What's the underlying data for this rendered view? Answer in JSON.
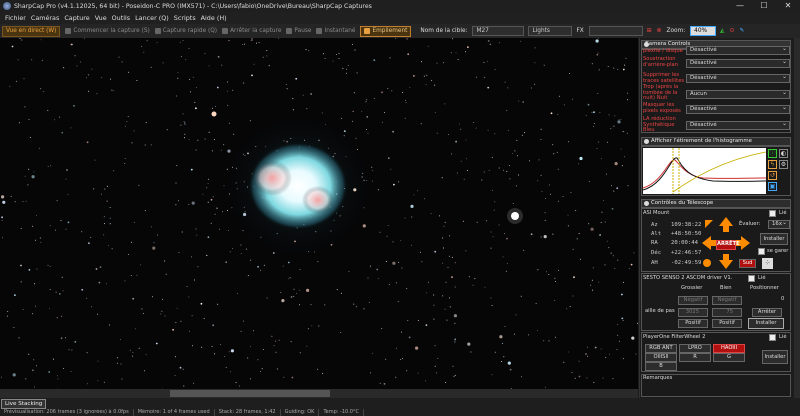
{
  "window": {
    "title": "SharpCap Pro (v4.1.12025, 64 bit) - Poseidon-C PRO (IMX571) - C:\\Users\\fabio\\OneDrive\\Bureau\\SharpCap Captures",
    "min": "—",
    "max": "☐",
    "close": "✕"
  },
  "menu": [
    "Fichier",
    "Caméras",
    "Capture",
    "Vue",
    "Outils",
    "Lancer (Q)",
    "Scripts",
    "Aide (H)"
  ],
  "toolbar": {
    "live": "Vue en direct (W)",
    "start_capture": "Commencer la capture (S)",
    "quick_capture": "Capture rapide (Q)",
    "stop_capture": "Arrêter la capture",
    "pause": "Pause",
    "snapshot": "Instantané",
    "stacking": "Empilement",
    "target_label": "Nom de la cible:",
    "target_value": "M27",
    "frame_type": "Lights",
    "fx_label": "FX",
    "zoom_label": "Zoom:",
    "zoom_value": "40%"
  },
  "panel": {
    "camera_controls_title": "Camera Controls",
    "camera_rows": [
      {
        "label": "plexite / disque",
        "value": "Désactivé"
      },
      {
        "label": "Soustraction d'arrière-plan",
        "value": "Désactivé"
      },
      {
        "label": "Supprimer les traces satellites",
        "value": "Désactivé"
      },
      {
        "label": "Trop (après la tombée de la nuit) Nuit",
        "value": "Aucun"
      },
      {
        "label": "Masquer les pixels exposés",
        "value": "Désactivé"
      },
      {
        "label": "LA réduction Synthétique Bleu",
        "value": "Désactivé"
      }
    ],
    "histogram_title": "Afficher l'étirement de l'histogramme",
    "telescope_title": "Contrôles du Télescope",
    "mount": {
      "name": "ASI Mount",
      "linked_label": "Lié",
      "az": "109:38:22",
      "alt": "+48:50:50",
      "ra": "20:00:44",
      "dec": "+22:46:57",
      "ah": "-02:49:59",
      "coord_labels": [
        "Az",
        "Alt",
        "RA",
        "Déc",
        "AH"
      ],
      "slew_label": "Évaluer:",
      "slew_value": "16x",
      "install_button": "Installer",
      "stop_button": "ARRÊTE",
      "south_label": "Sud",
      "park_label": "se garer"
    },
    "focuser": {
      "name": "SESTO SENSO 2 ASCOM driver V1.",
      "linked_label": "Lié",
      "col_coarse": "Grossier",
      "col_fine": "Bien",
      "col_position": "Positionner",
      "neg_label": "Négatif",
      "pos_label": "Positif",
      "step_label": "aille de pas",
      "coarse_step": "3025",
      "fine_step": "75",
      "position_value": "0",
      "stop_button": "Arrêter",
      "install_button": "Installer"
    },
    "filterwheel": {
      "name": "PlayerOne FilterWheel 2",
      "linked_label": "Lié",
      "filters": [
        "RGB ANT",
        "LPRO",
        "HAOIII",
        "OIIISII",
        "R",
        "G",
        "B"
      ],
      "active_filter": "HAOIII",
      "install_button": "Installer"
    },
    "remarks_label": "Remarques"
  },
  "status": {
    "live_tab": "Live Stacking",
    "items": [
      "Prévisualisation: 206 trames (3 ignorées) à 0.0fps",
      "Mémoire: 1 of 4 frames used",
      "Stack: 28 frames, 1:42",
      "Guiding: OK",
      "Temp: -10.0°C"
    ]
  },
  "colors": {
    "accent": "#e8a040",
    "stop_red": "#b01010",
    "zoom_highlight": "#4aa8ff"
  },
  "icons": {
    "arrows": "orange-direction-arrows",
    "histogram": "histogram-curve"
  }
}
